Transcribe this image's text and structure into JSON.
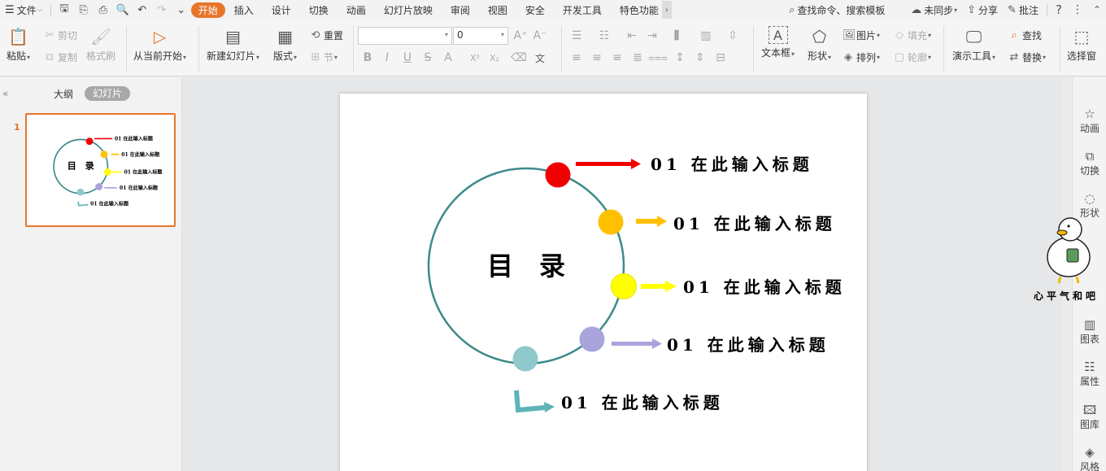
{
  "tabbar": {
    "file_menu": "文件",
    "tabs": [
      "开始",
      "插入",
      "设计",
      "切换",
      "动画",
      "幻灯片放映",
      "审阅",
      "视图",
      "安全",
      "开发工具",
      "特色功能"
    ],
    "active_tab": "开始",
    "search_placeholder": "查找命令、搜索模板",
    "sync": "未同步",
    "share": "分享",
    "comment": "批注",
    "help": "?"
  },
  "ribbon": {
    "paste": "粘贴",
    "cut": "剪切",
    "copy": "复制",
    "format_painter": "格式刷",
    "play_from_current": "从当前开始",
    "new_slide": "新建幻灯片",
    "layout": "版式",
    "reset": "重置",
    "section": "节",
    "font_name": "",
    "font_size": "0",
    "textbox": "文本框",
    "shape": "形状",
    "picture": "图片",
    "fill": "填充",
    "arrange": "排列",
    "outline": "轮廓",
    "present_tools": "演示工具",
    "find": "查找",
    "replace": "替换",
    "select_pane": "选择窗"
  },
  "left_panel": {
    "outline_tab": "大纲",
    "slides_tab": "幻灯片",
    "slide_number": "1"
  },
  "slide": {
    "title": "目　录",
    "items": [
      {
        "text": "01 在此输入标题",
        "color": "#f00000"
      },
      {
        "text": "01 在此输入标题",
        "color": "#ffc000"
      },
      {
        "text": "01 在此输入标题",
        "color": "#ffff00"
      },
      {
        "text": "01 在此输入标题",
        "color": "#a9a4db"
      },
      {
        "text": "01 在此输入标题",
        "color": "#8fc9cc"
      }
    ],
    "circle_color": "#3d8a8a"
  },
  "right_sidebar": {
    "items": [
      {
        "icon": "star-icon",
        "label": "动画"
      },
      {
        "icon": "transition-icon",
        "label": "切换"
      },
      {
        "icon": "shape-icon",
        "label": "形状"
      },
      {
        "icon": "chart-icon",
        "label": "图表"
      },
      {
        "icon": "property-icon",
        "label": "属性"
      },
      {
        "icon": "gallery-icon",
        "label": "图库"
      },
      {
        "icon": "style-icon",
        "label": "风格"
      }
    ]
  },
  "sticker": {
    "caption": "心平气和吧"
  }
}
